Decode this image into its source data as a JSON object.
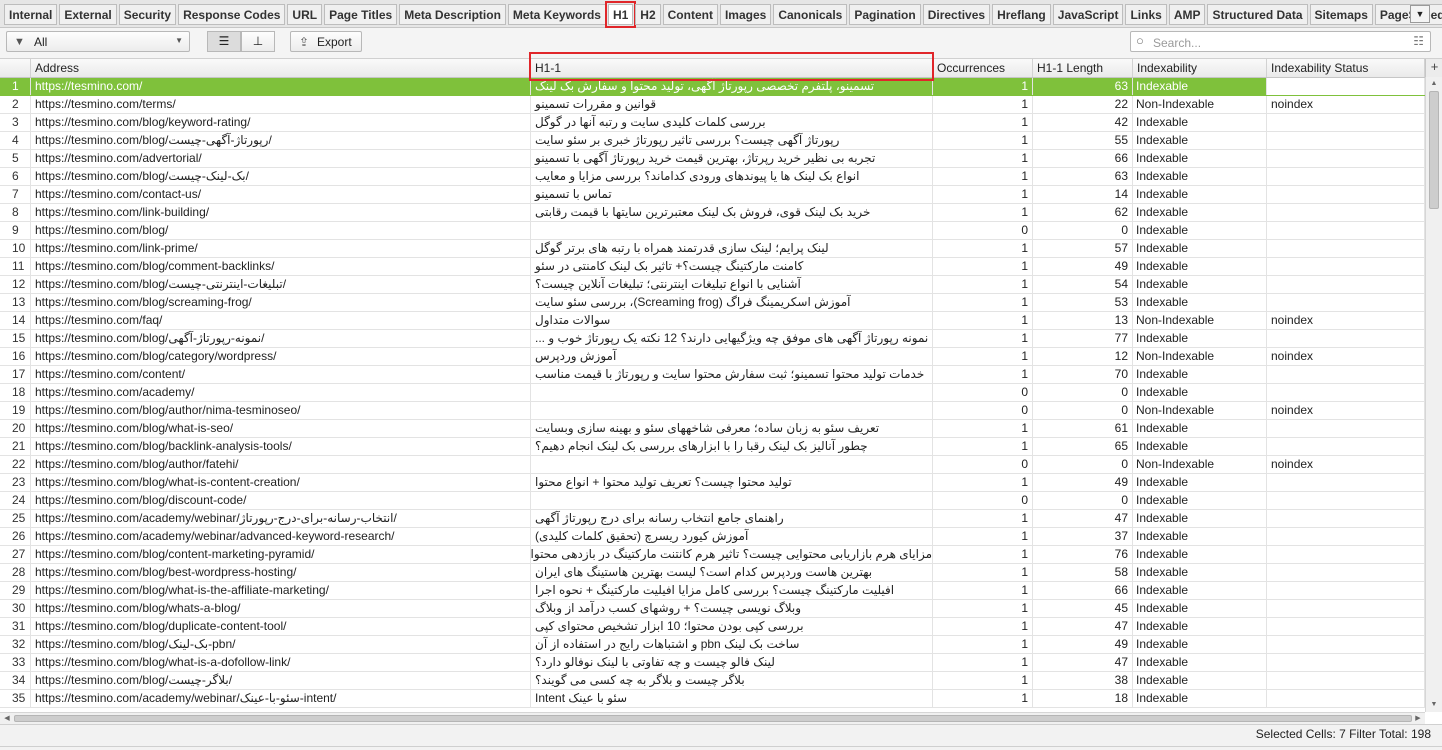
{
  "tabs": [
    {
      "label": "Internal",
      "active": false
    },
    {
      "label": "External",
      "active": false
    },
    {
      "label": "Security",
      "active": false
    },
    {
      "label": "Response Codes",
      "active": false
    },
    {
      "label": "URL",
      "active": false
    },
    {
      "label": "Page Titles",
      "active": false
    },
    {
      "label": "Meta Description",
      "active": false
    },
    {
      "label": "Meta Keywords",
      "active": false
    },
    {
      "label": "H1",
      "active": true
    },
    {
      "label": "H2",
      "active": false
    },
    {
      "label": "Content",
      "active": false
    },
    {
      "label": "Images",
      "active": false
    },
    {
      "label": "Canonicals",
      "active": false
    },
    {
      "label": "Pagination",
      "active": false
    },
    {
      "label": "Directives",
      "active": false
    },
    {
      "label": "Hreflang",
      "active": false
    },
    {
      "label": "JavaScript",
      "active": false
    },
    {
      "label": "Links",
      "active": false
    },
    {
      "label": "AMP",
      "active": false
    },
    {
      "label": "Structured Data",
      "active": false
    },
    {
      "label": "Sitemaps",
      "active": false
    },
    {
      "label": "PageSpeed",
      "active": false
    },
    {
      "label": "C",
      "active": false
    }
  ],
  "tab_overflow_icon": "chevron-down-icon",
  "toolbar": {
    "filter_icon": "funnel-icon",
    "filter_value": "All",
    "list_view_icon": "list-icon",
    "tree_view_icon": "tree-icon",
    "export_icon": "upload-icon",
    "export_label": "Export",
    "search_placeholder": "Search...",
    "search_icon": "magnifier-icon",
    "search_settings_icon": "sliders-icon"
  },
  "columns": [
    "Address",
    "H1-1",
    "Occurrences",
    "H1-1 Length",
    "Indexability",
    "Indexability Status"
  ],
  "add_column_icon": "plus-icon",
  "rows": [
    {
      "n": "1",
      "address": "https://tesmino.com/",
      "h1": "تسمینو، پلتفرم تخصصی رپورتاژ آگهی، تولید محتوا و سفارش بک لینک",
      "occ": "1",
      "len": "63",
      "idx": "Indexable",
      "status": ""
    },
    {
      "n": "2",
      "address": "https://tesmino.com/terms/",
      "h1": "قوانین و مقررات تسمینو",
      "occ": "1",
      "len": "22",
      "idx": "Non-Indexable",
      "status": "noindex"
    },
    {
      "n": "3",
      "address": "https://tesmino.com/blog/keyword-rating/",
      "h1": "بررسی کلمات کلیدی سایت و رتبه آنها در گوگل",
      "occ": "1",
      "len": "42",
      "idx": "Indexable",
      "status": ""
    },
    {
      "n": "4",
      "address": "https://tesmino.com/blog/رپورتاژ-آگهی-چیست/",
      "h1": "رپورتاژ آگهی چیست؟ بررسی تاثیر رپورتاژ خبری بر سئو سایت",
      "occ": "1",
      "len": "55",
      "idx": "Indexable",
      "status": ""
    },
    {
      "n": "5",
      "address": "https://tesmino.com/advertorial/",
      "h1": "تجربه بی نظیر خرید رپرتاژ، بهترین قیمت خرید رپورتاژ آگهی با تسمینو",
      "occ": "1",
      "len": "66",
      "idx": "Indexable",
      "status": ""
    },
    {
      "n": "6",
      "address": "https://tesmino.com/blog/بک-لینک-چیست/",
      "h1": "انواع بک لینک ها یا پیوندهای ورودی کداماند؟ بررسی مزایا و معایب",
      "occ": "1",
      "len": "63",
      "idx": "Indexable",
      "status": ""
    },
    {
      "n": "7",
      "address": "https://tesmino.com/contact-us/",
      "h1": "تماس با تسمینو",
      "occ": "1",
      "len": "14",
      "idx": "Indexable",
      "status": ""
    },
    {
      "n": "8",
      "address": "https://tesmino.com/link-building/",
      "h1": "خرید بک لینک قوی، فروش بک لینک معتبرترین سایتها با قیمت رقابتی",
      "occ": "1",
      "len": "62",
      "idx": "Indexable",
      "status": ""
    },
    {
      "n": "9",
      "address": "https://tesmino.com/blog/",
      "h1": "",
      "occ": "0",
      "len": "0",
      "idx": "Indexable",
      "status": ""
    },
    {
      "n": "10",
      "address": "https://tesmino.com/link-prime/",
      "h1": "لینک پرایم؛ لینک سازی قدرتمند همراه با رتبه های برتر گوگل",
      "occ": "1",
      "len": "57",
      "idx": "Indexable",
      "status": ""
    },
    {
      "n": "11",
      "address": "https://tesmino.com/blog/comment-backlinks/",
      "h1": "کامنت مارکتینگ چیست؟+ تاثیر بک لینک کامنتی در سئو",
      "occ": "1",
      "len": "49",
      "idx": "Indexable",
      "status": ""
    },
    {
      "n": "12",
      "address": "https://tesmino.com/blog/تبلیغات-اینترنتی-چیست/",
      "h1": "آشنایی با انواع تبلیغات اینترنتی؛ تبلیغات آنلاین چیست؟",
      "occ": "1",
      "len": "54",
      "idx": "Indexable",
      "status": ""
    },
    {
      "n": "13",
      "address": "https://tesmino.com/blog/screaming-frog/",
      "h1": "آموزش اسکریمینگ فراگ (Screaming frog)، بررسی سئو سایت",
      "occ": "1",
      "len": "53",
      "idx": "Indexable",
      "status": ""
    },
    {
      "n": "14",
      "address": "https://tesmino.com/faq/",
      "h1": "سوالات متداول",
      "occ": "1",
      "len": "13",
      "idx": "Non-Indexable",
      "status": "noindex"
    },
    {
      "n": "15",
      "address": "https://tesmino.com/blog/نمونه-رپورتاژ-آگهی/",
      "h1": "نمونه رپورتاژ آگهی های موفق چه ویژگیهایی دارند؟ 12 نکته یک رپورتاژ خوب و ...",
      "occ": "1",
      "len": "77",
      "idx": "Indexable",
      "status": ""
    },
    {
      "n": "16",
      "address": "https://tesmino.com/blog/category/wordpress/",
      "h1": "آموزش وردپرس",
      "occ": "1",
      "len": "12",
      "idx": "Non-Indexable",
      "status": "noindex"
    },
    {
      "n": "17",
      "address": "https://tesmino.com/content/",
      "h1": "خدمات تولید محتوا تسمینو؛ ثبت سفارش محتوا سایت و رپورتاژ با قیمت مناسب",
      "occ": "1",
      "len": "70",
      "idx": "Indexable",
      "status": ""
    },
    {
      "n": "18",
      "address": "https://tesmino.com/academy/",
      "h1": "",
      "occ": "0",
      "len": "0",
      "idx": "Indexable",
      "status": ""
    },
    {
      "n": "19",
      "address": "https://tesmino.com/blog/author/nima-tesminoseo/",
      "h1": "",
      "occ": "0",
      "len": "0",
      "idx": "Non-Indexable",
      "status": "noindex"
    },
    {
      "n": "20",
      "address": "https://tesmino.com/blog/what-is-seo/",
      "h1": "تعریف سئو به زبان ساده؛ معرفی شاخههای سئو و بهینه سازی وبسایت",
      "occ": "1",
      "len": "61",
      "idx": "Indexable",
      "status": ""
    },
    {
      "n": "21",
      "address": "https://tesmino.com/blog/backlink-analysis-tools/",
      "h1": "چطور آنالیز بک لینک رقبا را با ابزارهای بررسی بک لینک انجام دهیم؟",
      "occ": "1",
      "len": "65",
      "idx": "Indexable",
      "status": ""
    },
    {
      "n": "22",
      "address": "https://tesmino.com/blog/author/fatehi/",
      "h1": "",
      "occ": "0",
      "len": "0",
      "idx": "Non-Indexable",
      "status": "noindex"
    },
    {
      "n": "23",
      "address": "https://tesmino.com/blog/what-is-content-creation/",
      "h1": "تولید محتوا چیست؟ تعریف تولید محتوا + انواع محتوا",
      "occ": "1",
      "len": "49",
      "idx": "Indexable",
      "status": ""
    },
    {
      "n": "24",
      "address": "https://tesmino.com/blog/discount-code/",
      "h1": "",
      "occ": "0",
      "len": "0",
      "idx": "Indexable",
      "status": ""
    },
    {
      "n": "25",
      "address": "https://tesmino.com/academy/webinar/انتخاب-رسانه-برای-درج-رپورتاژ/",
      "h1": "راهنمای جامع انتخاب رسانه برای درج رپورتاژ آگهی",
      "occ": "1",
      "len": "47",
      "idx": "Indexable",
      "status": ""
    },
    {
      "n": "26",
      "address": "https://tesmino.com/academy/webinar/advanced-keyword-research/",
      "h1": "آموزش کیورد ریسرچ (تحقیق کلمات کلیدی)",
      "occ": "1",
      "len": "37",
      "idx": "Indexable",
      "status": ""
    },
    {
      "n": "27",
      "address": "https://tesmino.com/blog/content-marketing-pyramid/",
      "h1": "مزایای هرم بازاریابی محتوایی چیست؟ تاثیر هرم کانتنت مارکتینگ در بازدهی محتوا",
      "occ": "1",
      "len": "76",
      "idx": "Indexable",
      "status": ""
    },
    {
      "n": "28",
      "address": "https://tesmino.com/blog/best-wordpress-hosting/",
      "h1": "بهترین هاست وردپرس کدام است؟ لیست بهترین هاستینگ های ایران",
      "occ": "1",
      "len": "58",
      "idx": "Indexable",
      "status": ""
    },
    {
      "n": "29",
      "address": "https://tesmino.com/blog/what-is-the-affiliate-marketing/",
      "h1": "افیلیت مارکتینگ چیست؟ بررسی کامل مزایا افیلیت مارکتینگ + نحوه اجرا",
      "occ": "1",
      "len": "66",
      "idx": "Indexable",
      "status": ""
    },
    {
      "n": "30",
      "address": "https://tesmino.com/blog/whats-a-blog/",
      "h1": "وبلاگ نویسی چیست؟ + روشهای کسب درآمد از وبلاگ",
      "occ": "1",
      "len": "45",
      "idx": "Indexable",
      "status": ""
    },
    {
      "n": "31",
      "address": "https://tesmino.com/blog/duplicate-content-tool/",
      "h1": "بررسی کپی بودن محتوا؛ 10 ابزار تشخیص محتوای کپی",
      "occ": "1",
      "len": "47",
      "idx": "Indexable",
      "status": ""
    },
    {
      "n": "32",
      "address": "https://tesmino.com/blog/بک-لینک-pbn/",
      "h1": "ساخت بک لینک pbn و اشتباهات رایج در استفاده از آن",
      "occ": "1",
      "len": "49",
      "idx": "Indexable",
      "status": ""
    },
    {
      "n": "33",
      "address": "https://tesmino.com/blog/what-is-a-dofollow-link/",
      "h1": "لینک فالو چیست و چه تفاوتی با لینک نوفالو دارد؟",
      "occ": "1",
      "len": "47",
      "idx": "Indexable",
      "status": ""
    },
    {
      "n": "34",
      "address": "https://tesmino.com/blog/بلاگر-چیست/",
      "h1": "بلاگر چیست و بلاگر به چه کسی می گویند؟",
      "occ": "1",
      "len": "38",
      "idx": "Indexable",
      "status": ""
    },
    {
      "n": "35",
      "address": "https://tesmino.com/academy/webinar/سئو-با-عینک-intent/",
      "h1": "سئو با عینک Intent",
      "occ": "1",
      "len": "18",
      "idx": "Indexable",
      "status": ""
    }
  ],
  "selected_row": 1,
  "status": {
    "selected_cells_label": "Selected Cells:",
    "selected_cells_value": "7",
    "filter_total_label": "Filter Total:",
    "filter_total_value": "198"
  },
  "colors": {
    "selection": "#7fc13b",
    "highlight_box": "#e0262a"
  }
}
